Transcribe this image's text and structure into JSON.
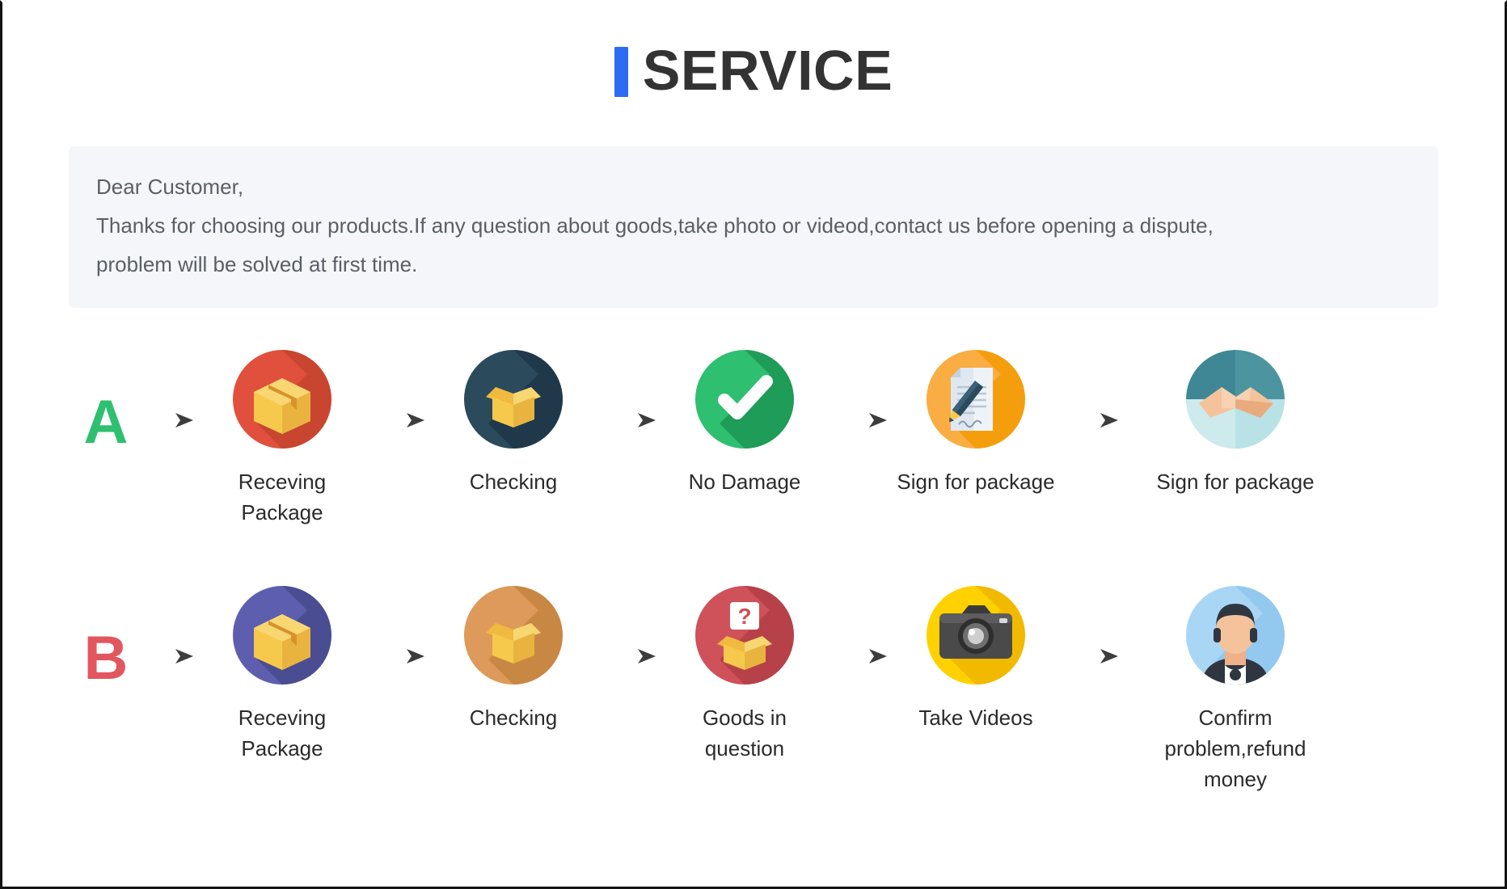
{
  "header": {
    "title": "SERVICE",
    "accent_color": "#2d6bf5",
    "title_color": "#333333"
  },
  "notice": {
    "background": "#f5f6fa",
    "line1": "Dear Customer,",
    "line2": "Thanks for choosing our products.If any question about goods,take photo or videod,contact us before opening a dispute,",
    "line3": "problem will be solved at first time."
  },
  "flows": [
    {
      "letter": "A",
      "letter_color": "#2fbf71",
      "steps": [
        {
          "label": "Receving Package",
          "icon": "closed-box-icon",
          "circle_color": "#e0503c",
          "shadow_color": "#c8452f"
        },
        {
          "label": "Checking",
          "icon": "open-box-icon",
          "circle_color": "#2b4a5c",
          "shadow_color": "#20394a"
        },
        {
          "label": "No Damage",
          "icon": "check-mark-icon",
          "circle_color": "#2fbf71",
          "shadow_color": "#1e9c58"
        },
        {
          "label": "Sign for package",
          "icon": "document-pen-icon",
          "circle_color": "#f9ad42",
          "shadow_color": "#f49e0d"
        },
        {
          "label": "Sign for package",
          "icon": "handshake-icon",
          "circle_color": "#a6dbe0",
          "shadow_color": "#49919c"
        }
      ]
    },
    {
      "letter": "B",
      "letter_color": "#e2565f",
      "steps": [
        {
          "label": "Receving Package",
          "icon": "closed-box-icon",
          "circle_color": "#5d5fae",
          "shadow_color": "#4b4d92"
        },
        {
          "label": "Checking",
          "icon": "open-box-icon",
          "circle_color": "#dd9a5a",
          "shadow_color": "#c98744"
        },
        {
          "label": "Goods in question",
          "icon": "question-box-icon",
          "circle_color": "#cf5159",
          "shadow_color": "#b74148"
        },
        {
          "label": "Take Videos",
          "icon": "camera-icon",
          "circle_color": "#ffd100",
          "shadow_color": "#f1b900"
        },
        {
          "label": "Confirm problem,refund\nmoney",
          "icon": "support-agent-icon",
          "circle_color": "#a9d6f5",
          "shadow_color": "#89c2ea"
        }
      ]
    }
  ],
  "arrow": {
    "name": "right-arrow-icon",
    "color": "#4a4a4a"
  }
}
